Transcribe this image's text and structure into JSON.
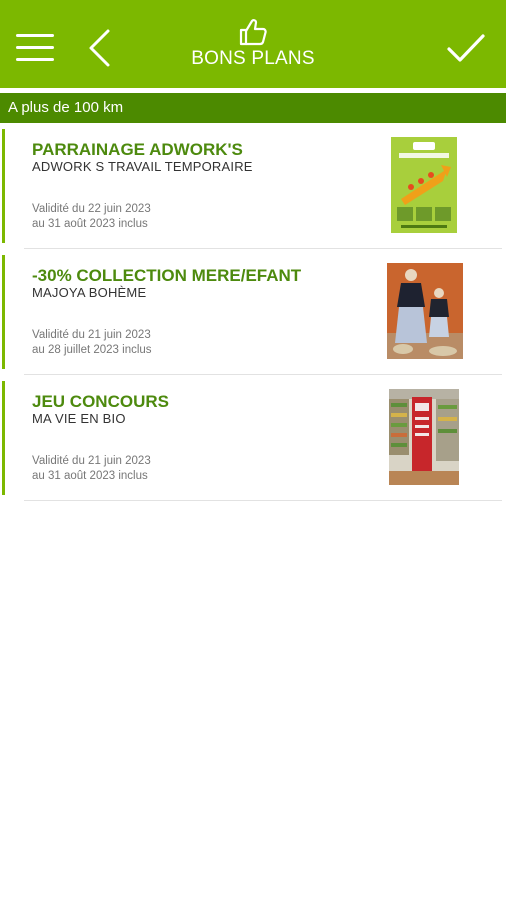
{
  "header": {
    "title": "BONS PLANS",
    "icons": {
      "menu": "hamburger-menu-icon",
      "back": "chevron-left-icon",
      "title": "thumbs-up-icon",
      "confirm": "checkmark-icon"
    }
  },
  "filter": {
    "distance_label": "A plus de 100 km"
  },
  "offers": [
    {
      "title": "PARRAINAGE ADWORK'S",
      "subtitle": "ADWORK S TRAVAIL TEMPORAIRE",
      "valid_from": "Validité du 22 juin 2023",
      "valid_to": "au 31 août 2023 inclus",
      "image": "adwork-poster-image"
    },
    {
      "title": "-30% COLLECTION MERE/EFANT",
      "subtitle": "MAJOYA BOHÈME",
      "valid_from": "Validité du 21 juin 2023",
      "valid_to": "au 28 juillet 2023 inclus",
      "image": "clothing-display-image"
    },
    {
      "title": "JEU CONCOURS",
      "subtitle": "MA VIE EN BIO",
      "valid_from": "Validité du 21 juin 2023",
      "valid_to": "au 31 août 2023 inclus",
      "image": "organic-shop-interior-image"
    }
  ],
  "colors": {
    "primary": "#7cb800",
    "secondary": "#4c8a00",
    "title_text": "#4d8a0e"
  }
}
